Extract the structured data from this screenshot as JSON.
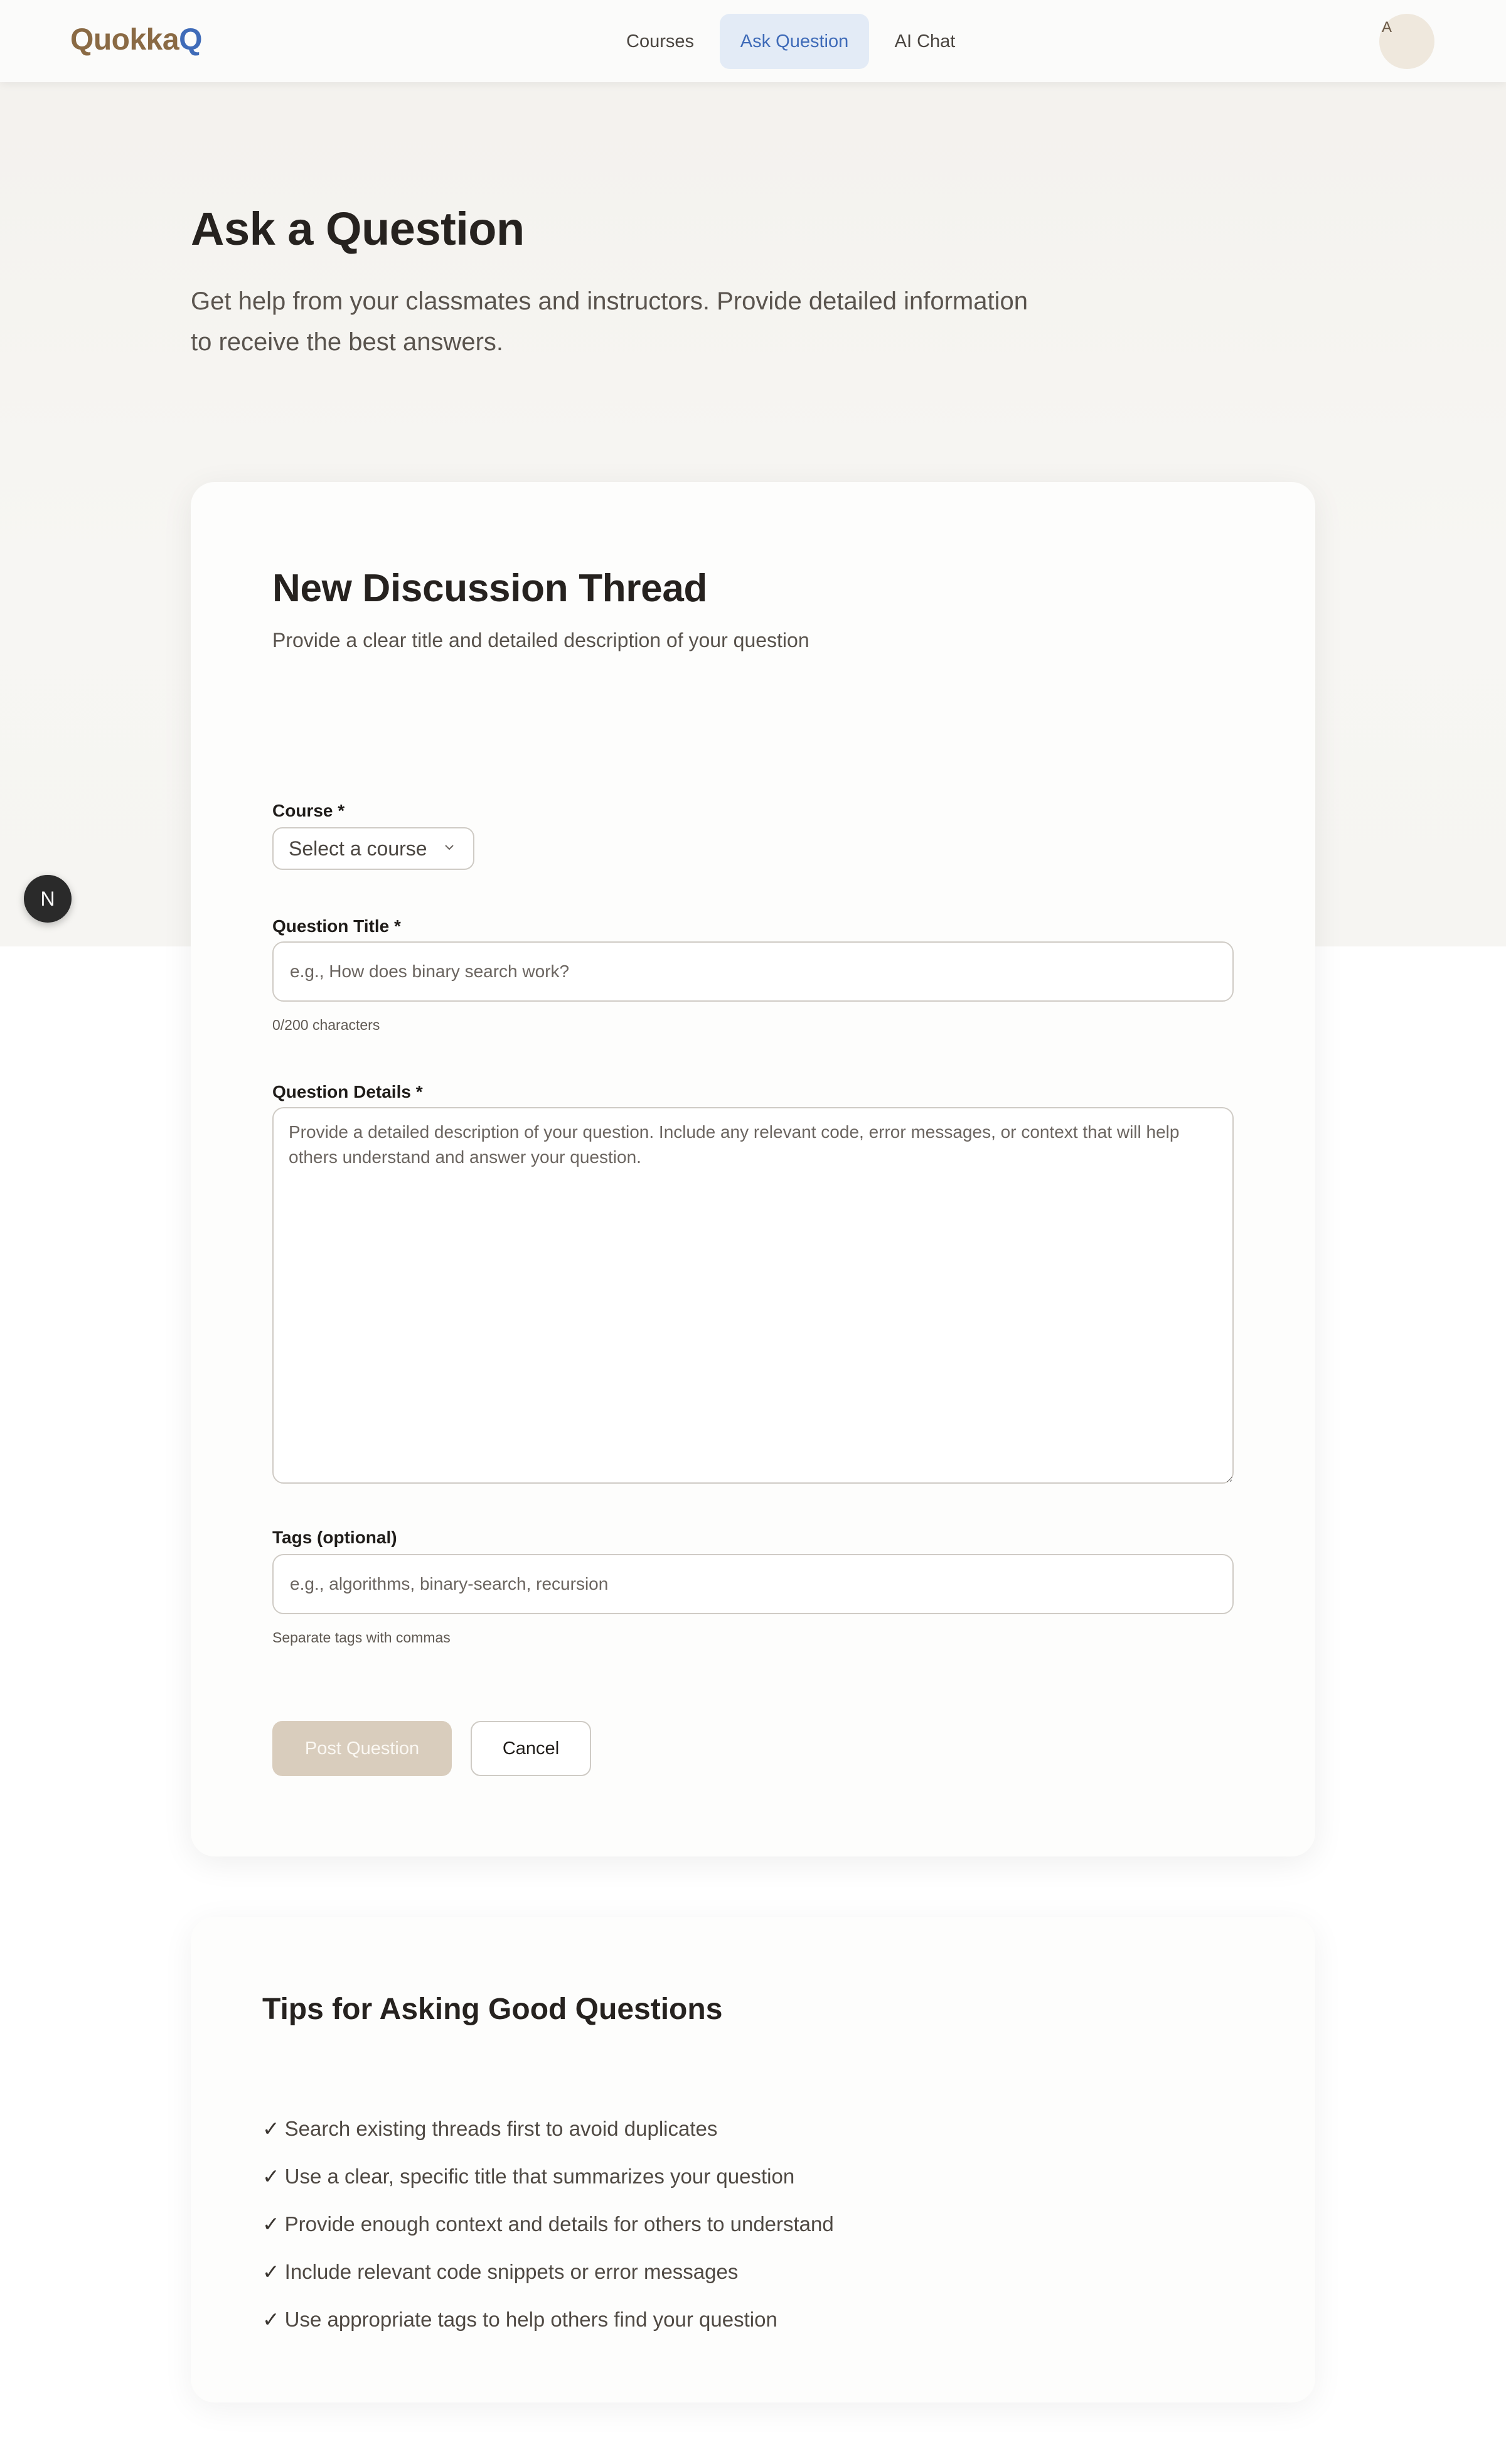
{
  "header": {
    "logo_part1": "Quokka",
    "logo_part2": "Q",
    "nav": [
      {
        "label": "Courses",
        "active": false
      },
      {
        "label": "Ask Question",
        "active": true
      },
      {
        "label": "AI Chat",
        "active": false
      }
    ],
    "avatar_initial": "A"
  },
  "page": {
    "title": "Ask a Question",
    "subtitle": "Get help from your classmates and instructors. Provide detailed information to receive the best answers."
  },
  "fab": {
    "label": "N"
  },
  "form": {
    "title": "New Discussion Thread",
    "subtitle": "Provide a clear title and detailed description of your question",
    "course_label": "Course *",
    "course_value": "Select a course",
    "title_label": "Question Title *",
    "title_placeholder": "e.g., How does binary search work?",
    "title_value": "",
    "title_counter": "0/200 characters",
    "details_label": "Question Details *",
    "details_placeholder": "Provide a detailed description of your question. Include any relevant code, error messages, or context that will help others understand and answer your question.",
    "details_value": "",
    "tags_label": "Tags (optional)",
    "tags_placeholder": "e.g., algorithms, binary-search, recursion",
    "tags_value": "",
    "tags_hint": "Separate tags with commas",
    "post_button": "Post Question",
    "post_enabled": false,
    "cancel_button": "Cancel"
  },
  "tips": {
    "title": "Tips for Asking Good Questions",
    "check_symbol": "✓",
    "items": [
      "Search existing threads first to avoid duplicates",
      "Use a clear, specific title that summarizes your question",
      "Provide enough context and details for others to understand",
      "Include relevant code snippets or error messages",
      "Use appropriate tags to help others find your question"
    ]
  },
  "colors": {
    "brand_brown": "#8a6a44",
    "brand_blue": "#3f6bb8",
    "nav_active_bg": "#e3ebf6",
    "post_button_disabled": "#d9cdbd"
  }
}
